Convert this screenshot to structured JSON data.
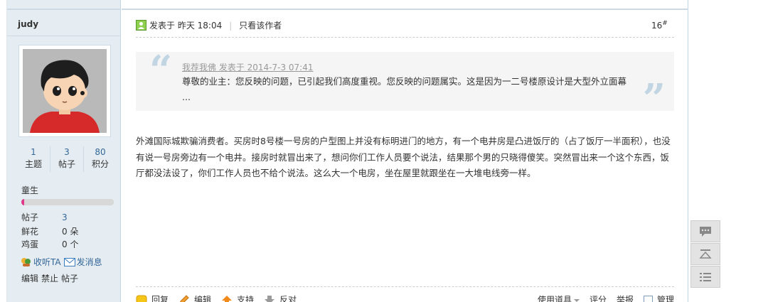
{
  "author": {
    "username": "judy",
    "stats": [
      {
        "num": "1",
        "label": "主题"
      },
      {
        "num": "3",
        "label": "帖子"
      },
      {
        "num": "80",
        "label": "积分"
      }
    ],
    "level": "童生",
    "level_progress": 0.03,
    "info": [
      {
        "label": "帖子",
        "value": "3"
      },
      {
        "label": "鲜花",
        "value": "0 朵"
      },
      {
        "label": "鸡蛋",
        "value": "0 个"
      }
    ],
    "actions": {
      "follow": "收听TA",
      "message": "发消息"
    },
    "manage": [
      "编辑",
      "禁止",
      "帖子"
    ]
  },
  "post": {
    "posted_label": "发表于 昨天 18:04",
    "only_author": "只看该作者",
    "floor_number": "16",
    "floor_mark": "#",
    "quote": {
      "header": "我荐我佛 发表于 2014-7-3 07:41",
      "body": "尊敬的业主：您反映的问题，已引起我们高度重视。您反映的问题属实。这是因为一二号楼原设计是大型外立面幕 ..."
    },
    "content": "外滩国际城欺骗消费者。买房时8号楼一号房的户型图上并没有标明进门的地方，有一个电井房是凸进饭厅的（占了饭厅一半面积），也没有说一号房旁边有一个电井。接房时就冒出来了，想问你们工作人员要个说法，结果那个男的只晓得傻笑。突然冒出来一个这个东西，饭厅都没法设了，你们工作人员也不给个说法。这么大一个电房，坐在屋里就跟坐在一大堆电线旁一样。"
  },
  "bottom_bar": {
    "reply": "回复",
    "edit": "编辑",
    "support": "支持",
    "oppose": "反对",
    "use_item": "使用道具",
    "rate": "评分",
    "report": "举报",
    "manage": "管理"
  },
  "icons": {
    "online": "online-user-icon",
    "follow": "follow-icon",
    "message": "message-icon",
    "float": [
      "comment-icon",
      "back-to-top-icon",
      "list-icon"
    ]
  },
  "colors": {
    "link": "#336699",
    "sidebar_bg": "#e5edf2",
    "border": "#c2d5e3",
    "progress": "#e0388b"
  }
}
